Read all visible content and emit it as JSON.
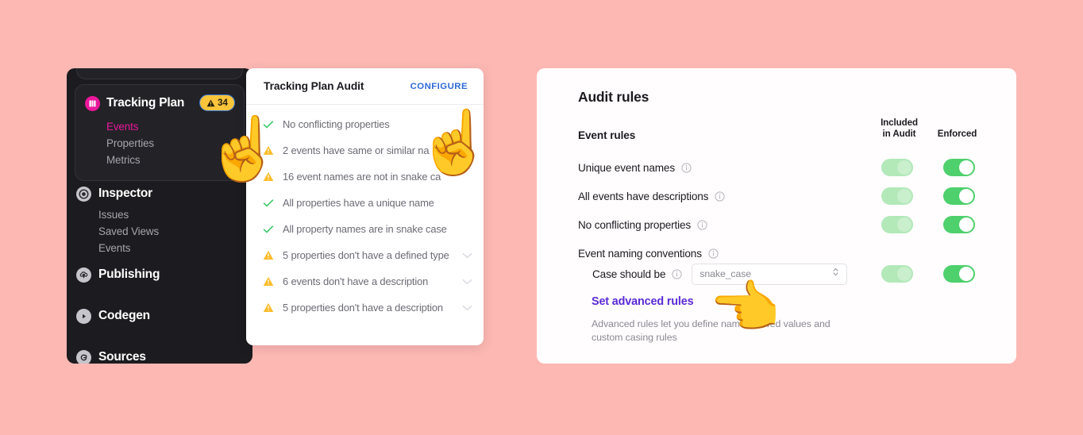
{
  "background_color": "#fdb8b3",
  "sidebar": {
    "tracking_plan": {
      "icon": "book-icon",
      "label": "Tracking Plan",
      "badge": {
        "icon": "warning-triangle-icon",
        "count": "34"
      },
      "sub_items": [
        {
          "label": "Events",
          "active": true
        },
        {
          "label": "Properties",
          "active": false
        },
        {
          "label": "Metrics",
          "active": false
        }
      ]
    },
    "groups": [
      {
        "icon": "target-icon",
        "label": "Inspector",
        "sub_items": [
          {
            "label": "Issues"
          },
          {
            "label": "Saved Views"
          },
          {
            "label": "Events"
          }
        ]
      },
      {
        "icon": "cloud-upload-icon",
        "label": "Publishing",
        "sub_items": []
      },
      {
        "icon": "play-icon",
        "label": "Codegen",
        "sub_items": []
      },
      {
        "icon": "sources-icon",
        "label": "Sources",
        "sub_items": []
      }
    ],
    "accent_active": "#ea179b",
    "badge_color": "#fcc53b"
  },
  "audit_popover": {
    "title": "Tracking Plan Audit",
    "configure_label": "CONFIGURE",
    "configure_color": "#2e6bd8",
    "items": [
      {
        "status": "pass",
        "text": "No conflicting properties",
        "expandable": false
      },
      {
        "status": "warn",
        "text": "2 events have same or similar na",
        "expandable": false
      },
      {
        "status": "warn",
        "text": "16 event names are not in snake ca",
        "expandable": false
      },
      {
        "status": "pass",
        "text": "All properties have a unique name",
        "expandable": false
      },
      {
        "status": "pass",
        "text": "All property names are in snake case",
        "expandable": false
      },
      {
        "status": "warn",
        "text": "5 properties don't have a defined type",
        "expandable": true
      },
      {
        "status": "warn",
        "text": "6 events don't have a description",
        "expandable": true
      },
      {
        "status": "warn",
        "text": "5 properties don't have a description",
        "expandable": true
      }
    ]
  },
  "rules_panel": {
    "title": "Audit rules",
    "section_label": "Event rules",
    "column_headers": {
      "included": "Included\nin Audit",
      "included_line1": "Included",
      "included_line2": "in Audit",
      "enforced": "Enforced"
    },
    "rules": [
      {
        "name": "Unique event names",
        "info": true,
        "included": "on-pale",
        "enforced": "on-vivid"
      },
      {
        "name": "All events have descriptions",
        "info": true,
        "included": "on-pale",
        "enforced": "on-vivid"
      },
      {
        "name": "No conflicting properties",
        "info": true,
        "included": "on-pale",
        "enforced": "on-vivid"
      },
      {
        "name": "Event naming conventions",
        "info": true,
        "included": null,
        "enforced": null
      }
    ],
    "case_rule": {
      "name": "Case should be",
      "info": true,
      "select_value": "snake_case",
      "included": "on-pale",
      "enforced": "on-vivid"
    },
    "advanced": {
      "link_label": "Set advanced rules",
      "link_color": "#5b2bd6",
      "description": "Advanced rules let you define name              allowed values and custom casing rules"
    },
    "toggle_colors": {
      "pale": "#b3e8b9",
      "vivid": "#4ed06d"
    }
  },
  "cursors": [
    {
      "name": "pointing-up-hand",
      "glyph": "☝"
    },
    {
      "name": "pointing-up-hand",
      "glyph": "☝"
    },
    {
      "name": "pointing-left-hand",
      "glyph": "👈"
    }
  ]
}
